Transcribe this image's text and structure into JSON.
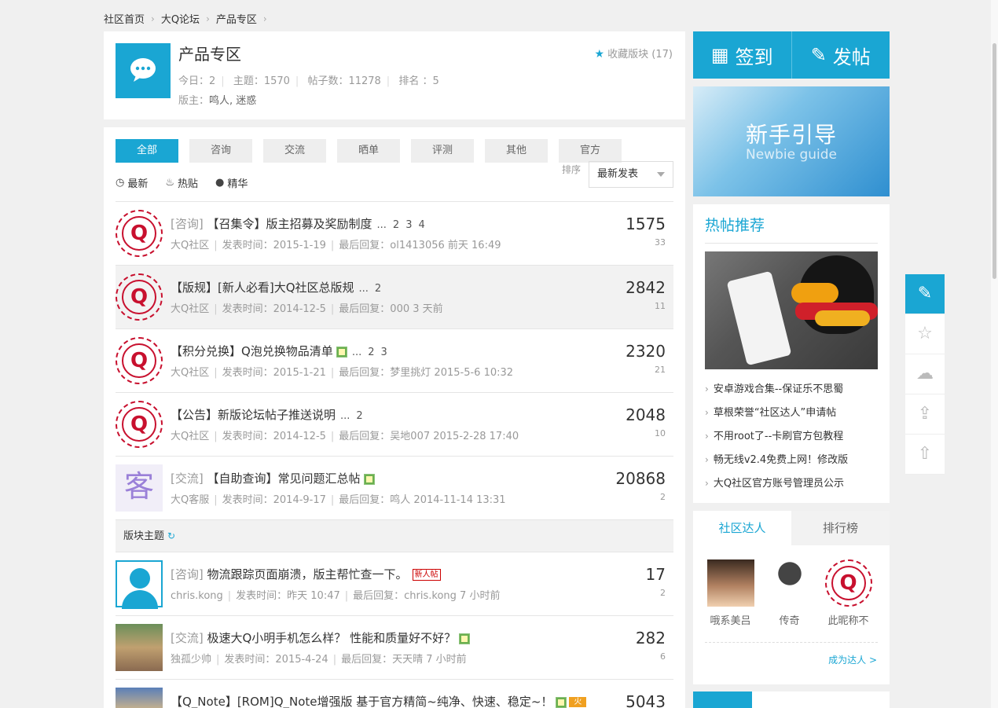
{
  "breadcrumb": [
    "社区首页",
    "大Q论坛",
    "产品专区"
  ],
  "forum": {
    "title": "产品专区",
    "today_label": "今日：2",
    "topics_label": "主题：1570",
    "posts_label": "帖子数：11278",
    "rank_label": "排名 ：5",
    "moderators_label": "版主：",
    "moderators": "鸣人, 迷惑",
    "favorite": "收藏版块 (17)"
  },
  "tabs": [
    "全部",
    "咨询",
    "交流",
    "晒单",
    "评测",
    "其他",
    "官方"
  ],
  "filters": [
    "最新",
    "热贴",
    "精华"
  ],
  "sort": {
    "label": "排序",
    "value": "最新发表"
  },
  "pinned": [
    {
      "cat": "[咨询]",
      "title": "【召集令】版主招募及奖励制度",
      "pages": [
        "...",
        "2",
        "3",
        "4"
      ],
      "author": "大Q社区",
      "posted": "发表时间：2015-1-19",
      "last": "最后回复：ol1413056  前天 16:49",
      "replies": "1575",
      "views": "33"
    },
    {
      "cat": "",
      "title": "【版规】[新人必看]大Q社区总版规",
      "pages": [
        "...",
        "2"
      ],
      "author": "大Q社区",
      "posted": "发表时间：2014-12-5",
      "last": "最后回复：000  3 天前",
      "replies": "2842",
      "views": "11"
    },
    {
      "cat": "",
      "title": "【积分兑换】Q泡兑换物品清单",
      "pages": [
        "...",
        "2",
        "3"
      ],
      "author": "大Q社区",
      "posted": "发表时间：2015-1-21",
      "last": "最后回复：梦里挑灯  2015-5-6 10:32",
      "replies": "2320",
      "views": "21"
    },
    {
      "cat": "",
      "title": "【公告】新版论坛帖子推送说明",
      "pages": [
        "...",
        "2"
      ],
      "author": "大Q社区",
      "posted": "发表时间：2014-12-5",
      "last": "最后回复：吴地007  2015-2-28 17:40",
      "replies": "2048",
      "views": "10"
    },
    {
      "cat": "[交流]",
      "title": "【自助查询】常见问题汇总帖",
      "pages": [],
      "author": "大Q客服",
      "posted": "发表时间：2014-9-17",
      "last": "最后回复：鸣人  2014-11-14 13:31",
      "replies": "20868",
      "views": "2"
    }
  ],
  "section_header": "版块主题",
  "threads": [
    {
      "cat": "[咨询]",
      "title": "物流跟踪页面崩溃，版主帮忙查一下。",
      "badge": "新人帖",
      "author": "chris.kong",
      "posted": "发表时间：昨天 10:47",
      "last": "最后回复：chris.kong  7 小时前",
      "replies": "17",
      "views": "2"
    },
    {
      "cat": "[交流]",
      "title": "极速大Q小明手机怎么样？ 性能和质量好不好？",
      "author": "独孤少帅",
      "posted": "发表时间：2015-4-24",
      "last": "最后回复：天天晴  7 小时前",
      "replies": "282",
      "views": "6"
    },
    {
      "cat": "",
      "title": "【Q_Note】[ROM]Q_Note增强版 基于官方精简~纯净、快速、稳定~！",
      "author": "",
      "posted": "",
      "last": "",
      "replies": "5043",
      "views": ""
    }
  ],
  "sidebar": {
    "checkin": "签到",
    "post": "发帖",
    "banner_zh": "新手引导",
    "banner_en": "Newbie guide",
    "hot_title": "热帖推荐",
    "hot_items": [
      "安卓游戏合集--保证乐不思蜀",
      "草根荣誉“社区达人”申请帖",
      "不用root了--卡刷官方包教程",
      "畅无线v2.4免费上网！修改版",
      "大Q社区官方账号管理员公示"
    ],
    "expert_tabs": [
      "社区达人",
      "排行榜"
    ],
    "experts": [
      "哦系美吕",
      "传奇",
      "此昵称不"
    ],
    "become": "成为达人 >"
  },
  "colors": {
    "accent": "#1aa6d3",
    "logo_red": "#c8102e"
  }
}
